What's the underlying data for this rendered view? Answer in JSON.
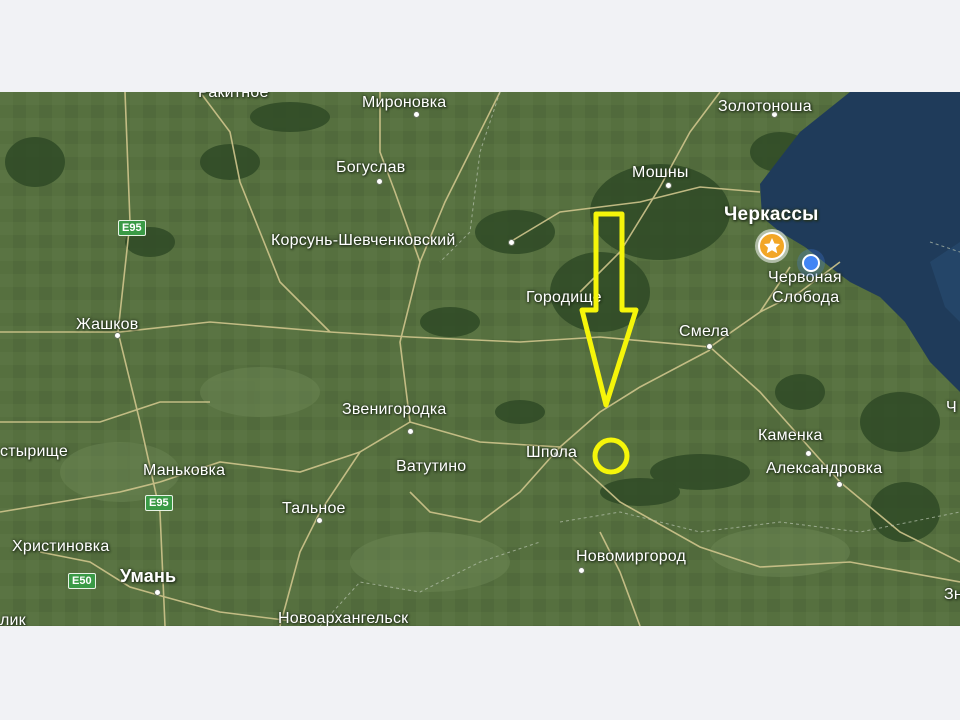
{
  "map": {
    "type": "satellite-map",
    "cities": {
      "rakitnoe": "Ракитное",
      "mironovka": "Мироновка",
      "zolotonosha": "Золотоноша",
      "boguslav": "Богуслав",
      "moshny": "Мошны",
      "cherkassy": "Черкассы",
      "korsun": "Корсунь-Шевченковский",
      "gorodische": "Городище",
      "chervonaya": "Червоная",
      "sloboda": "Слобода",
      "zhashkov": "Жашков",
      "smela": "Смела",
      "zvenigorodka": "Звенигородка",
      "kamenka": "Каменка",
      "styrishche": "стырище",
      "shpola": "Шпола",
      "vatutino": "Ватутино",
      "aleksandrovka": "Александровка",
      "mankovka": "Маньковка",
      "talnoe": "Тальное",
      "khristinovka": "Христиновка",
      "novomirgorod": "Новомиргород",
      "uman": "Умань",
      "novoarkhangelsk": "Новоархангельск",
      "edge_ch": "Ч",
      "edge_z": "Зн",
      "edge_lik": "лик"
    },
    "road_shields": {
      "e95_north": "E95",
      "e95_south": "E95",
      "e50": "E50"
    },
    "markers": {
      "saved_place": "star-marker",
      "current_location": "blue-location-dot"
    },
    "annotations": {
      "arrow_color": "#f5f50a",
      "circle_color": "#f5f50a"
    }
  }
}
